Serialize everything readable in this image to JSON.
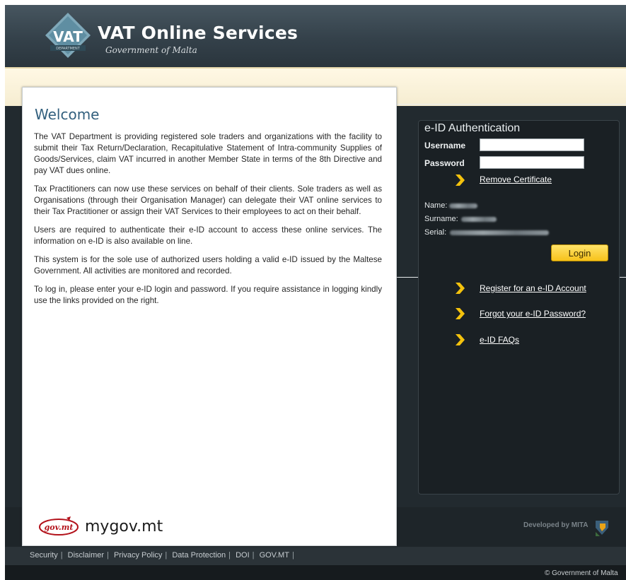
{
  "header": {
    "logo_text": "VAT",
    "logo_subtext": "DEPARTMENT",
    "title": "VAT Online Services",
    "subtitle": "Government of Malta"
  },
  "welcome": {
    "title": "Welcome",
    "paragraphs": [
      "The VAT Department is providing registered sole traders and organizations with the facility to submit their Tax Return/Declaration, Recapitulative Statement of Intra-community Supplies of Goods/Services, claim VAT incurred in another Member State in terms of the 8th Directive and pay VAT dues online.",
      "Tax Practitioners can now use these services on behalf of their clients. Sole traders as well as Organisations (through their Organisation Manager) can delegate their VAT online services to their Tax Practitioner or assign their VAT Services to their employees to act on their behalf.",
      "Users are required to authenticate their e-ID account to access these online services. The information on e-ID is also available on line.",
      "This system is for the sole use of authorized users holding a valid e-ID issued by the Maltese Government. All activities are monitored and recorded.",
      "To log in, please enter your e-ID login and password. If you require assistance in logging kindly use the links provided on the right."
    ],
    "mygov_badge": "gov.mt",
    "mygov_text": "mygov.mt"
  },
  "eid": {
    "title": "e-ID Authentication",
    "username_label": "Username",
    "username_value": "",
    "password_label": "Password",
    "password_value": "",
    "remove_certificate": "Remove Certificate",
    "name_label": "Name:",
    "surname_label": "Surname:",
    "serial_label": "Serial:",
    "login_button": "Login",
    "links": [
      "Register for an e-ID Account",
      "Forgot your e-ID Password?",
      "e-ID FAQs"
    ]
  },
  "branding": {
    "developed_by": "Developed by MITA"
  },
  "footer": {
    "links": [
      "Security",
      "Disclaimer",
      "Privacy Policy",
      "Data Protection",
      "DOI",
      "GOV.MT"
    ],
    "copyright": "© Government of Malta"
  },
  "colors": {
    "header_dark": "#34414a",
    "cream_band": "#fff8e4",
    "welcome_title": "#33607e",
    "login_button": "#f7c21a",
    "chevron": "#f4c20d"
  }
}
